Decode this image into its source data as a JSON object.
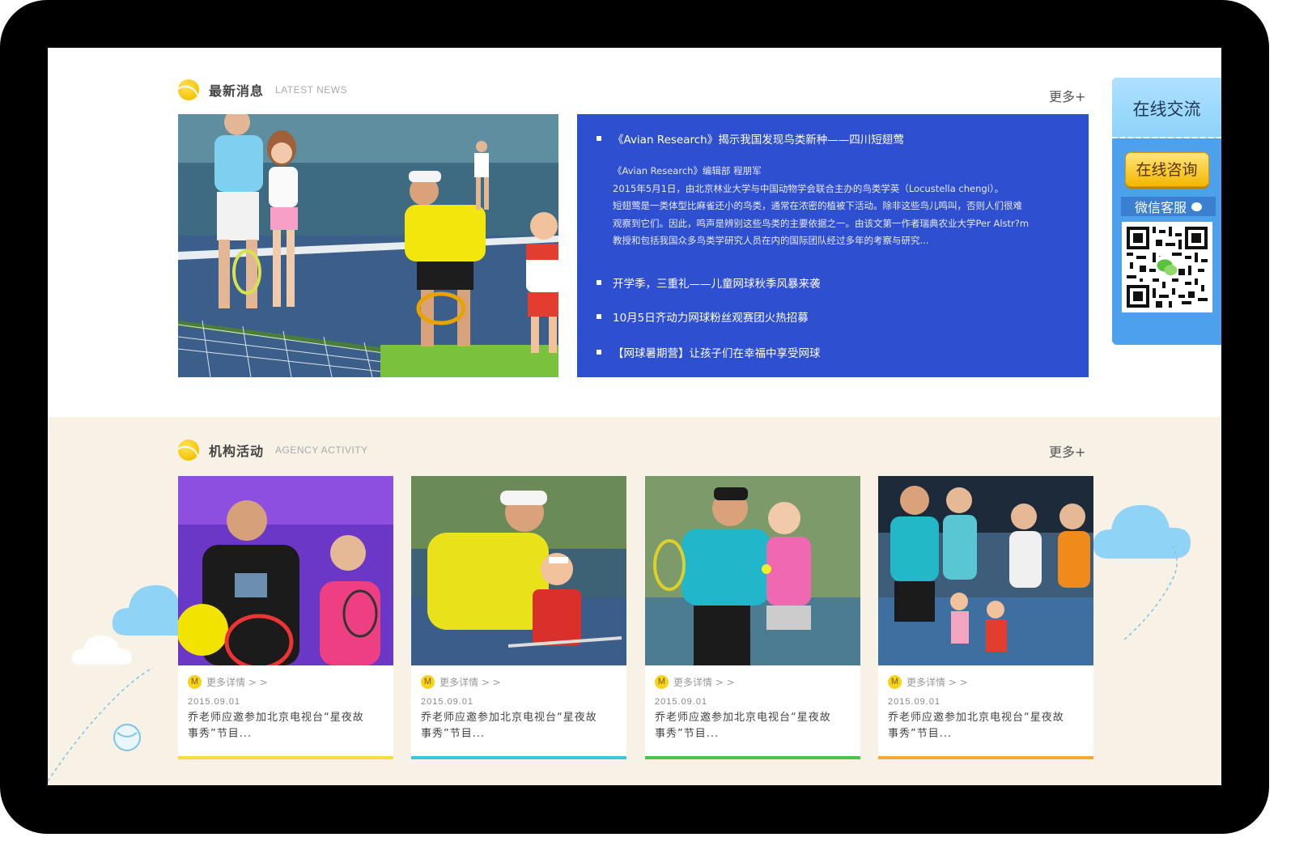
{
  "news": {
    "title": "最新消息",
    "subtitle": "LATEST NEWS",
    "more": "更多+",
    "items": [
      {
        "title": "《Avian Research》揭示我国发现鸟类新种——四川短翅莺",
        "detail": [
          "《Avian Research》编辑部  程朋军",
          "2015年5月1日，由北京林业大学与中国动物学会联合主办的鸟类学英（Locustella chengi）。",
          "短翅莺是一类体型比麻雀还小的鸟类，通常在浓密的植被下活动。除非这些鸟儿鸣叫，否则人们很难",
          "观察到它们。因此，鸣声是辨别这些鸟类的主要依据之一。由该文第一作者瑞典农业大学Per Alstr?m",
          "教授和包括我国众多鸟类学研究人员在内的国际团队经过多年的考察与研究..."
        ]
      },
      {
        "title": "开学季，三重礼——儿童网球秋季风暴来袭"
      },
      {
        "title": "10月5日齐动力网球粉丝观赛团火热招募"
      },
      {
        "title": "【网球暑期营】让孩子们在幸福中享受网球"
      }
    ]
  },
  "activity": {
    "title": "机构活动",
    "subtitle": "AGENCY ACTIVITY",
    "more": "更多+",
    "cards": [
      {
        "more": "更多详情 > >",
        "badge": "M",
        "date": "2015.09.01",
        "title_line1": "乔老师应邀参加北京电视台“星夜故",
        "title_line2": "事秀”节目...",
        "bar_color": "#f8dc3c"
      },
      {
        "more": "更多详情 > >",
        "badge": "M",
        "date": "2015.09.01",
        "title_line1": "乔老师应邀参加北京电视台“星夜故",
        "title_line2": "事秀”节目...",
        "bar_color": "#3dc6d9"
      },
      {
        "more": "更多详情 > >",
        "badge": "M",
        "date": "2015.09.01",
        "title_line1": "乔老师应邀参加北京电视台“星夜故",
        "title_line2": "事秀”节目...",
        "bar_color": "#4cc24f"
      },
      {
        "more": "更多详情 > >",
        "badge": "M",
        "date": "2015.09.01",
        "title_line1": "乔老师应邀参加北京电视台“星夜故",
        "title_line2": "事秀”节目...",
        "bar_color": "#f5a935"
      }
    ]
  },
  "side": {
    "title": "在线交流",
    "consult": "在线咨询",
    "wechat": "微信客服"
  },
  "colors": {
    "news_panel": "#2f4fd1",
    "activity_bg": "#f7f1e6",
    "side_bg": "#4da0ec"
  }
}
